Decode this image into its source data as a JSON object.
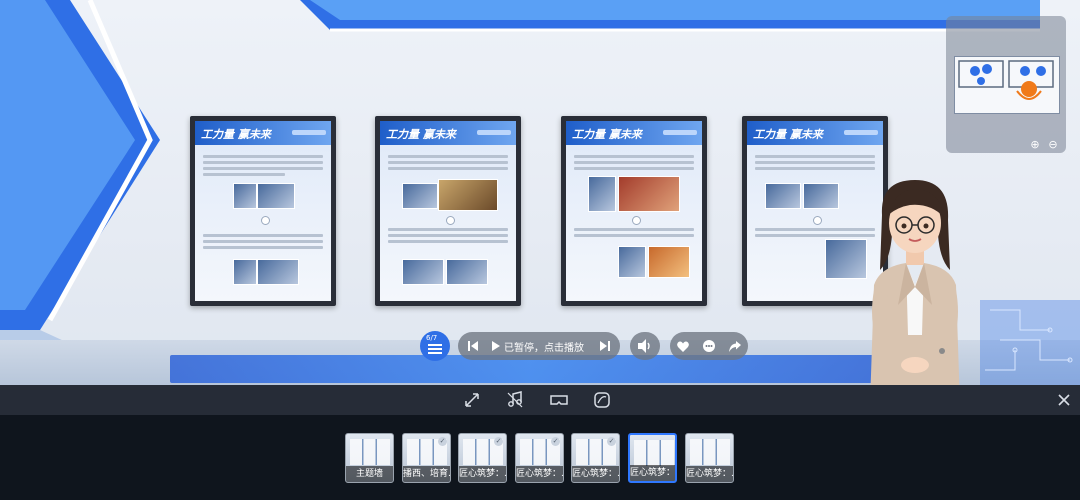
{
  "stage": {
    "posters": [
      {
        "title": "工力量 赢未来"
      },
      {
        "title": "工力量 赢未来"
      },
      {
        "title": "工力量 赢未来"
      },
      {
        "title": "工力量 赢未来"
      }
    ]
  },
  "controls": {
    "menu_count": "6/7",
    "play_status": "已暂停，点击播放"
  },
  "thumbnails": [
    {
      "label": "主题墙",
      "checked": false,
      "active": false
    },
    {
      "label": "播西、培育...",
      "checked": true,
      "active": false
    },
    {
      "label": "匠心筑梦：...",
      "checked": true,
      "active": false
    },
    {
      "label": "匠心筑梦：...",
      "checked": true,
      "active": false
    },
    {
      "label": "匠心筑梦：...",
      "checked": true,
      "active": false
    },
    {
      "label": "匠心筑梦：新芽...",
      "checked": false,
      "active": true
    },
    {
      "label": "匠心筑梦：...",
      "checked": false,
      "active": false
    }
  ],
  "colors": {
    "accent": "#2f6fe6",
    "toolbar_bg": "#262c37",
    "bottom_bg": "#0f151d",
    "poster_frame": "#2a2e38"
  },
  "icons": {
    "toolbar": [
      "fullscreen-icon",
      "music-note-icon",
      "vr-glasses-icon",
      "gyroscope-icon",
      "close-icon"
    ],
    "controls": [
      "playlist-icon",
      "skip-previous-icon",
      "play-icon",
      "skip-next-icon",
      "volume-icon",
      "like-icon",
      "comment-icon",
      "share-icon"
    ]
  }
}
